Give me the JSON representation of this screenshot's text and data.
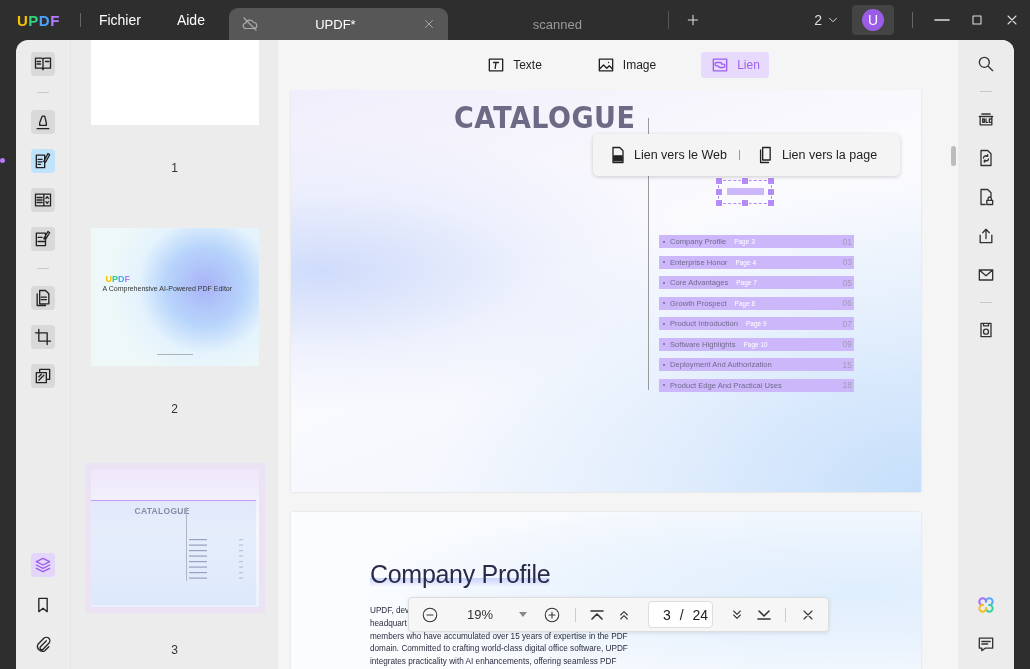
{
  "app_bar": {
    "logo": "UPDF",
    "menus": [
      "Fichier",
      "Aide"
    ],
    "tabs": [
      {
        "label": "UPDF*",
        "selected": true
      },
      {
        "label": "scanned",
        "selected": false
      }
    ],
    "window_count": "2",
    "avatar": "U"
  },
  "left_toolbar": {
    "tools": [
      {
        "selected": false
      },
      {
        "selected": false
      },
      {
        "selected": true
      },
      {
        "selected": false
      },
      {
        "selected": false
      },
      {
        "selected": false
      },
      {
        "selected": false
      },
      {
        "selected": false
      }
    ],
    "panels": [
      {
        "selected": true
      },
      {
        "selected": false
      },
      {
        "selected": false
      }
    ]
  },
  "thumbnails": [
    {
      "page": "1",
      "selected": false
    },
    {
      "page": "2",
      "selected": false,
      "logo": "UPDF",
      "subtitle": "A Comprehensive AI-Powered PDF Editor"
    },
    {
      "page": "3",
      "selected": true,
      "title": "CATALOGUE"
    }
  ],
  "edit_tools": [
    {
      "label": "Texte",
      "selected": false
    },
    {
      "label": "Image",
      "selected": false
    },
    {
      "label": "Lien",
      "selected": true
    }
  ],
  "catalogue_page": {
    "title": "CATALOGUE",
    "link_menu": [
      "Lien vers le Web",
      "Lien vers la page"
    ],
    "entries": [
      {
        "title": "Company Profile",
        "page": "Page 3",
        "number": "01"
      },
      {
        "title": "Enterprise Honor",
        "page": "Page 4",
        "number": "03"
      },
      {
        "title": "Core Advantages",
        "page": "Page 7",
        "number": "05"
      },
      {
        "title": "Growth Prospect",
        "page": "Page 8",
        "number": "06"
      },
      {
        "title": "Product Introduction",
        "page": "Page 9",
        "number": "07"
      },
      {
        "title": "Software Highlights",
        "page": "Page 10",
        "number": "09"
      },
      {
        "title": "Deployment And Authorization",
        "number": "15"
      },
      {
        "title": "Product Edge And Practical Uses",
        "number": "18"
      }
    ]
  },
  "profile_page": {
    "title": "Company Profile",
    "lines": [
      "UPDF, dev",
      "headquart",
      "members who have accumulated over 15 years of expertise in the PDF",
      "domain. Committed to crafting world-class digital office software, UPDF",
      "integrates practicality with AI enhancements, offering seamless PDF"
    ]
  },
  "zoom_bar": {
    "zoom": "19%",
    "page": "3",
    "separator": "/",
    "total": "24"
  }
}
